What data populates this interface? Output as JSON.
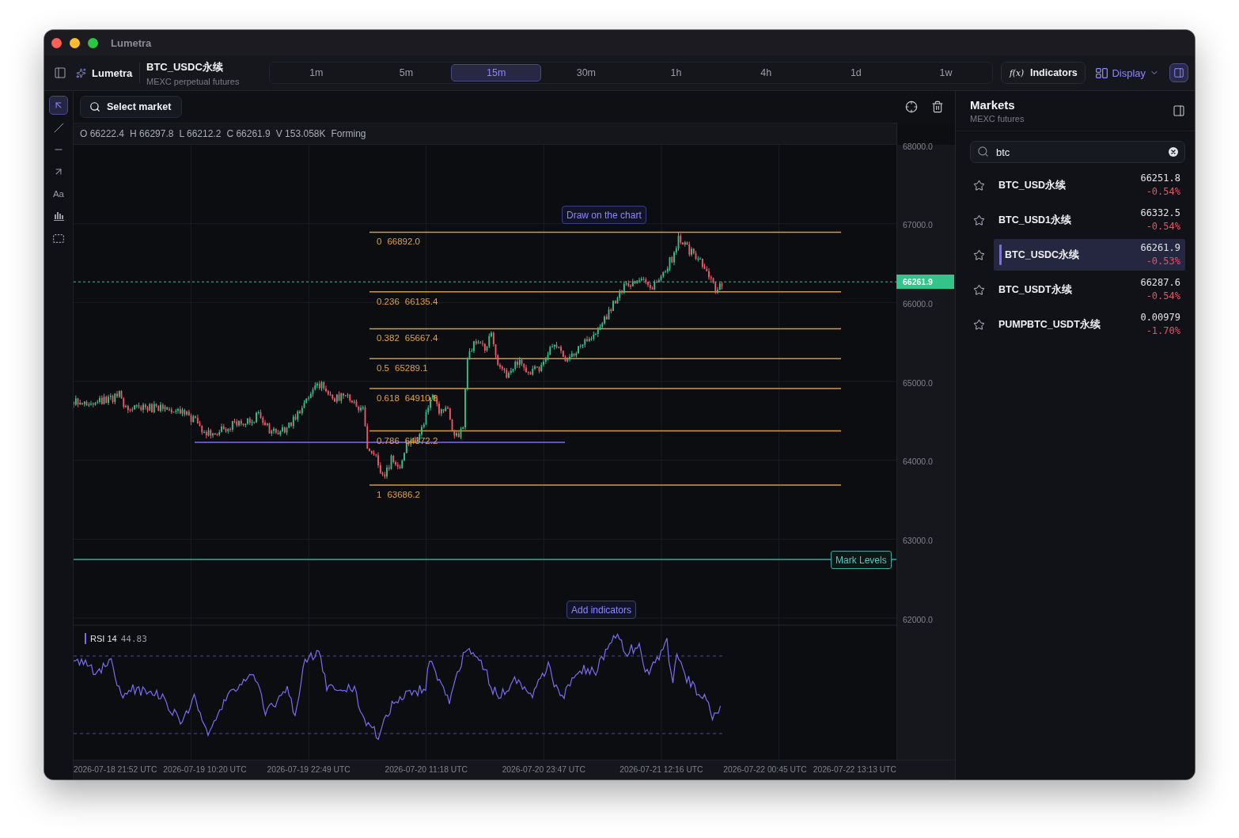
{
  "window": {
    "title": "Lumetra"
  },
  "toolbar": {
    "app_name": "Lumetra",
    "market": {
      "symbol": "BTC_USDC永续",
      "description": "MEXC perpetual futures"
    },
    "timeframes": [
      {
        "label": "1m",
        "selected": false
      },
      {
        "label": "5m",
        "selected": false
      },
      {
        "label": "15m",
        "selected": true
      },
      {
        "label": "30m",
        "selected": false
      },
      {
        "label": "1h",
        "selected": false
      },
      {
        "label": "4h",
        "selected": false
      },
      {
        "label": "1d",
        "selected": false
      },
      {
        "label": "1w",
        "selected": false
      }
    ],
    "indicators_button": {
      "symbol": "f(x)",
      "label": "Indicators"
    },
    "display_button": {
      "label": "Display"
    },
    "panel_toggle": {
      "selected": true
    }
  },
  "tools": [
    {
      "kind": "select",
      "selected": true
    },
    {
      "kind": "line",
      "selected": false
    },
    {
      "kind": "horizontal_line",
      "selected": false
    },
    {
      "kind": "arrow",
      "selected": false
    },
    {
      "kind": "text",
      "label": "Aa",
      "selected": false
    },
    {
      "kind": "bars",
      "selected": false
    },
    {
      "kind": "rectangle",
      "selected": false
    }
  ],
  "chart": {
    "market_button": "Select market",
    "ohlc": {
      "values": [
        "O 66222.4",
        "H 66297.8",
        "L 66212.2",
        "C 66261.9",
        "V 153.058K"
      ],
      "status": "Forming"
    },
    "price_axis": {
      "ticks": [
        "68000.0",
        "67000.0",
        "66000.0",
        "65000.0",
        "64000.0",
        "63000.0",
        "62000.0"
      ],
      "last_price": "66261.9"
    },
    "fibonacci": [
      {
        "ratio": "0",
        "price": "66892.0"
      },
      {
        "ratio": "0.236",
        "price": "66135.4"
      },
      {
        "ratio": "0.382",
        "price": "65667.4"
      },
      {
        "ratio": "0.5",
        "price": "65289.1"
      },
      {
        "ratio": "0.618",
        "price": "64910.8"
      },
      {
        "ratio": "0.786",
        "price": "64372.2"
      },
      {
        "ratio": "1",
        "price": "63686.2"
      }
    ],
    "draw_hint": "Draw on the chart",
    "level_label": "Mark Levels",
    "indicator_hint": "Add indicators",
    "rsi": {
      "name": "RSI 14",
      "value": "44.83"
    },
    "time_axis": [
      "2026-07-18 21:52 UTC",
      "2026-07-19 10:20 UTC",
      "2026-07-19 22:49 UTC",
      "2026-07-20 11:18 UTC",
      "2026-07-20 23:47 UTC",
      "2026-07-21 12:16 UTC",
      "2026-07-22 00:45 UTC",
      "2026-07-22 13:13 UTC"
    ]
  },
  "markets": {
    "title": "Markets",
    "subtitle": "MEXC futures",
    "search": {
      "value": "btc"
    },
    "items": [
      {
        "name": "BTC_USD永续",
        "price": "66251.8",
        "change": "-0.54%",
        "favorite": false,
        "selected": false
      },
      {
        "name": "BTC_USD1永续",
        "price": "66332.5",
        "change": "-0.54%",
        "favorite": false,
        "selected": false
      },
      {
        "name": "BTC_USDC永续",
        "price": "66261.9",
        "change": "-0.53%",
        "favorite": false,
        "selected": true
      },
      {
        "name": "BTC_USDT永续",
        "price": "66287.6",
        "change": "-0.54%",
        "favorite": false,
        "selected": false
      },
      {
        "name": "PUMPBTC_USDT永续",
        "price": "0.00979",
        "change": "-1.70%",
        "favorite": false,
        "selected": false
      }
    ]
  }
}
